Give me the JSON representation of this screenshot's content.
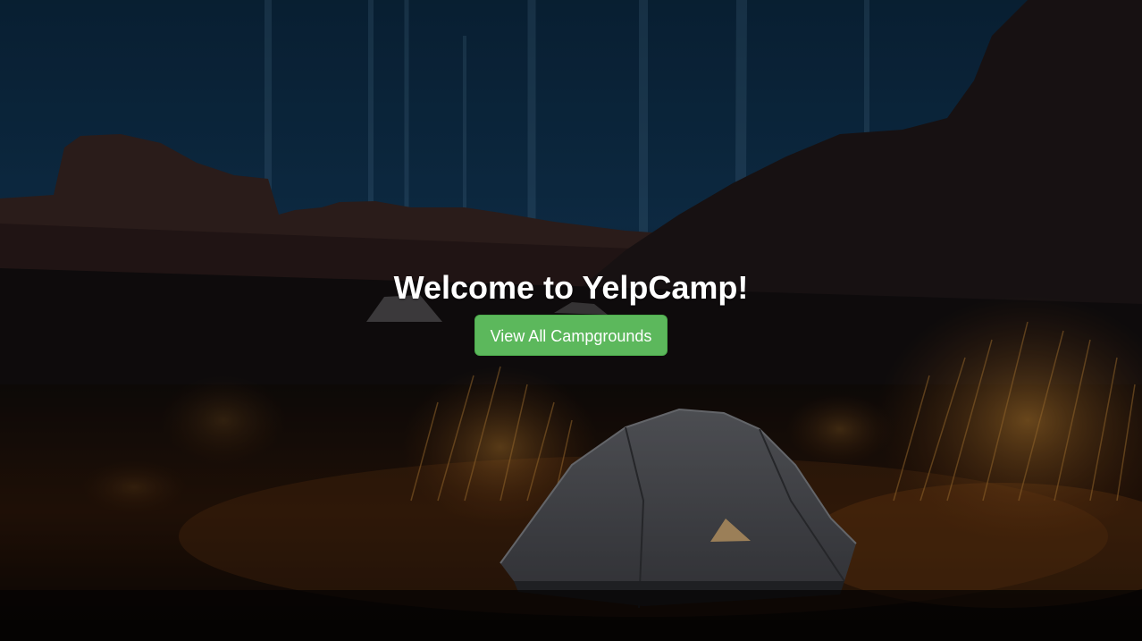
{
  "landing": {
    "title": "Welcome to YelpCamp!",
    "cta_label": "View All Campgrounds"
  },
  "background": {
    "subject": "tent at night in desert canyon",
    "colors": {
      "sky": "#0f3350",
      "rocks": "#3a2624",
      "ground": "#2a160c",
      "brush": "#c9842f",
      "tent": "#5a5d66",
      "button": "#5cb85c"
    }
  }
}
